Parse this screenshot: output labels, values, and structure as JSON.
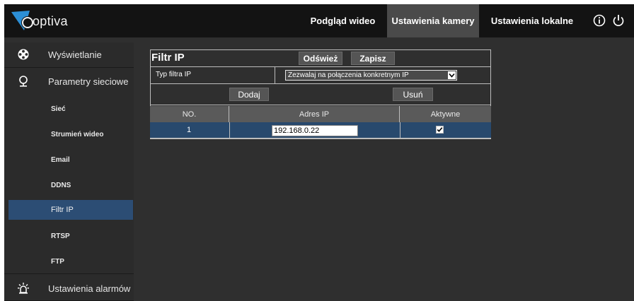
{
  "brand": {
    "name": "optiva"
  },
  "topnav": [
    {
      "label": "Podgląd wideo"
    },
    {
      "label": "Ustawienia kamery"
    },
    {
      "label": "Ustawienia lokalne"
    }
  ],
  "sidebar": {
    "groups": [
      {
        "label": "Wyświetlanie",
        "icon": "film-reel-icon"
      },
      {
        "label": "Parametry sieciowe",
        "icon": "globe-icon"
      },
      {
        "label": "Ustawienia alarmów",
        "icon": "alarm-light-icon"
      }
    ],
    "items": [
      {
        "label": "Sieć"
      },
      {
        "label": "Strumień wideo"
      },
      {
        "label": "Email"
      },
      {
        "label": "DDNS"
      },
      {
        "label": "Filtr IP"
      },
      {
        "label": "RTSP"
      },
      {
        "label": "FTP"
      }
    ]
  },
  "panel": {
    "title": "Filtr IP",
    "refresh_label": "Odśwież",
    "save_label": "Zapisz",
    "filter_type_label": "Typ filtra IP",
    "filter_type_value": "Zezwalaj na połączenia konkretnym IP",
    "add_label": "Dodaj",
    "delete_label": "Usuń",
    "columns": [
      "NO.",
      "Adres IP",
      "Aktywne"
    ],
    "rows": [
      {
        "no": "1",
        "ip": "192.168.0.22",
        "active": true
      }
    ]
  },
  "colors": {
    "selected_row": "#28496d",
    "topbar": "#131313",
    "active_nav": "#4a4a4a"
  }
}
